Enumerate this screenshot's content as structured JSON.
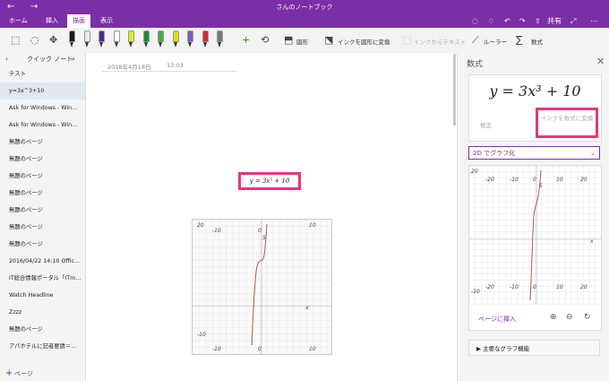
{
  "window": {
    "title": "さんのノートブック"
  },
  "tabs": [
    {
      "label": "ホーム"
    },
    {
      "label": "挿入"
    },
    {
      "label": "描画"
    },
    {
      "label": "表示"
    }
  ],
  "share_label": "共有",
  "toolbar": {
    "shapes_label": "図形",
    "ink_to_shape_label": "インクを図形に変換",
    "ink_to_text_label": "インクからテキスト",
    "ruler_label": "ルーラー",
    "math_label": "数式"
  },
  "pen_colors": [
    "#1a1a1a",
    "#e9e9e9",
    "#4a2a8a",
    "#ffffff",
    "#d7ee2a",
    "#1a8c2a",
    "#3fae3f",
    "#e2e000",
    "#7b5cc4",
    "#d12a2a",
    "#777777"
  ],
  "sidebar": {
    "header": "クイック ノート",
    "items": [
      {
        "label": "テスト"
      },
      {
        "label": "y=3x^3+10"
      },
      {
        "label": "Ask for Windows - Win..."
      },
      {
        "label": "Ask for Windows - Win..."
      },
      {
        "label": "無題のページ"
      },
      {
        "label": "無題のページ"
      },
      {
        "label": "無題のページ"
      },
      {
        "label": "無題のページ"
      },
      {
        "label": "無題のページ"
      },
      {
        "label": "無題のページ"
      },
      {
        "label": "無題のページ"
      },
      {
        "label": "2016/04/22 14:10 Offic..."
      },
      {
        "label": "IT総合情報ポータル「ITm..."
      },
      {
        "label": "Watch Headline"
      },
      {
        "label": "Zzzz"
      },
      {
        "label": "無題のページ"
      },
      {
        "label": "アパホテルに記者要請＝..."
      }
    ],
    "add_page": "ページ"
  },
  "page": {
    "date": "2018年4月18日",
    "time": "13:03",
    "equation": "y = 3x³ + 10",
    "graph": {
      "ticks_left": [
        "20",
        "-10",
        "-10"
      ],
      "ticks_right": [
        "10",
        "10",
        "x"
      ],
      "labels": [
        "0",
        "5",
        "0",
        "0"
      ]
    }
  },
  "math_panel": {
    "title": "数式",
    "equation": "y = 3x³ + 10",
    "fix_label": "修正",
    "convert_label": "インクを数式に変換",
    "dropdown_value": "2D でグラフ化",
    "insert_label": "ページに挿入",
    "features_label": "主要なグラフ機能"
  },
  "colors": {
    "accent": "#7b2fa6",
    "highlight": "#e4377a"
  }
}
